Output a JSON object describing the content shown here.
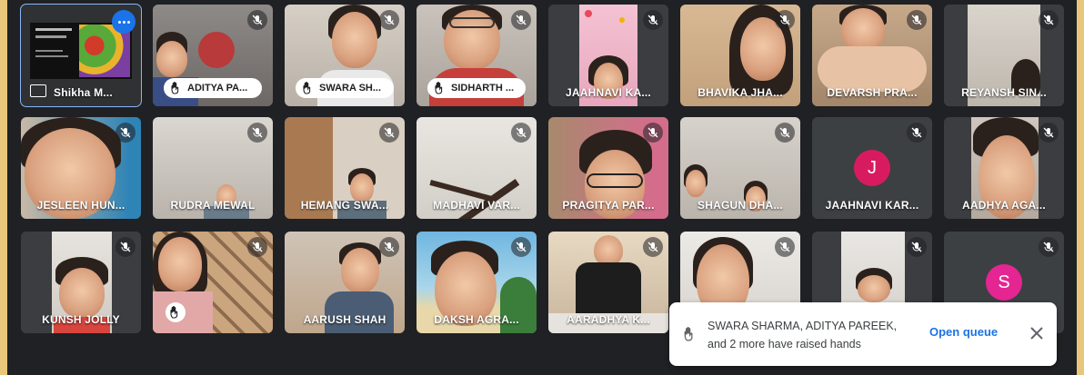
{
  "participants": {
    "self": {
      "name": "Shikha M..."
    },
    "aditya": {
      "name": "ADITYA PA..."
    },
    "swara": {
      "name": "SWARA SH..."
    },
    "sidharth": {
      "name": "SIDHARTH ..."
    },
    "jaahnavi_ka": {
      "name": "JAAHNAVI KA..."
    },
    "bhavika": {
      "name": "BHAVIKA JHA..."
    },
    "devarsh": {
      "name": "DEVARSH PRA..."
    },
    "reyansh": {
      "name": "REYANSH SIN..."
    },
    "jesleen": {
      "name": "JESLEEN HUN..."
    },
    "rudra": {
      "name": "RUDRA MEWAL"
    },
    "hemang": {
      "name": "HEMANG SWA..."
    },
    "madhavi": {
      "name": "MADHAVI VAR..."
    },
    "pragitya": {
      "name": "PRAGITYA PAR..."
    },
    "shagun": {
      "name": "SHAGUN DHA..."
    },
    "jaahnavi_kar": {
      "name": "JAAHNAVI KAR...",
      "avatar_letter": "J",
      "avatar_color": "#d81b60"
    },
    "aadhya": {
      "name": "AADHYA AGA..."
    },
    "kunsh": {
      "name": "KUNSH JOLLY"
    },
    "aarush": {
      "name": "AARUSH SHAH"
    },
    "daksh": {
      "name": "DAKSH AGRA..."
    },
    "aaradhya": {
      "name": "AARADHYA K..."
    },
    "s_user": {
      "avatar_letter": "S",
      "avatar_color": "#e52592"
    }
  },
  "toast": {
    "line1": "SWARA SHARMA, ADITYA PAREEK,",
    "line2": "and 2 more have raised hands",
    "button": "Open queue"
  },
  "colors": {
    "accent": "#1a73e8",
    "selfview_border": "#8ab4f8",
    "background": "#202124"
  },
  "icons": [
    "mic-off-icon",
    "raised-hand-icon",
    "more-options-icon",
    "present-icon",
    "close-icon"
  ]
}
